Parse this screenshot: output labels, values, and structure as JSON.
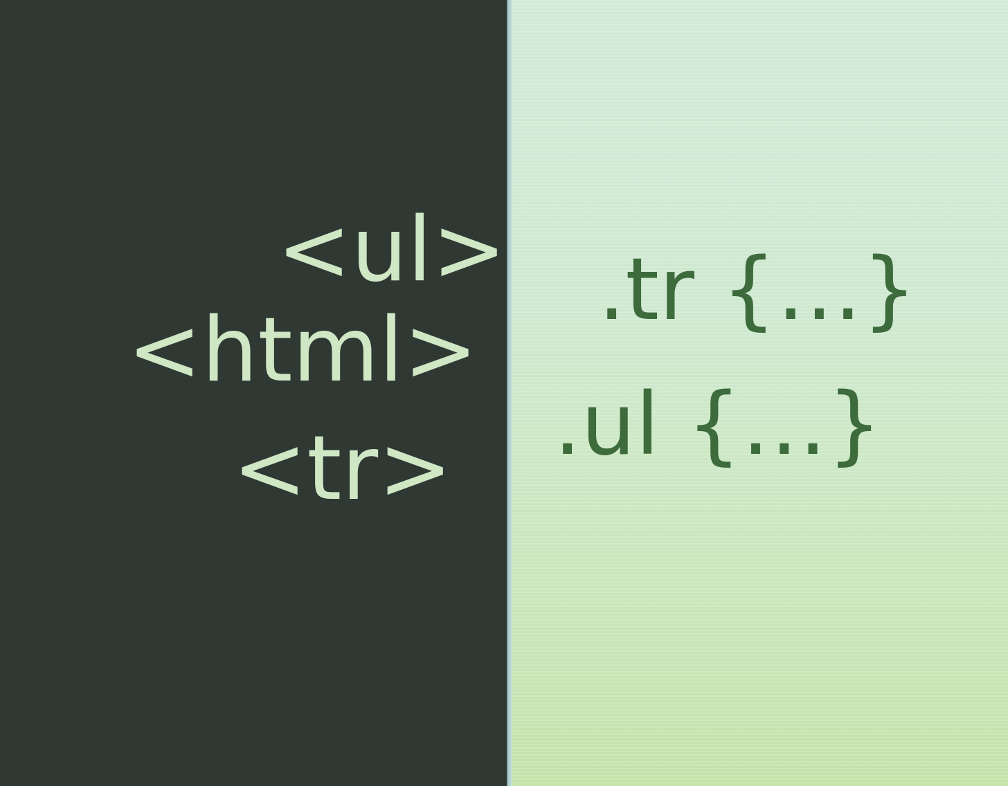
{
  "html_panel": {
    "tags": {
      "ul": "<ul>",
      "html": "<html>",
      "tr": "<tr>"
    }
  },
  "css_panel": {
    "rules": {
      "tr": ".tr {…}",
      "ul": ".ul {…}"
    }
  },
  "colors": {
    "left_background": "#2f3833",
    "tag_text": "#cfe7c4",
    "right_background": "#cde8c8",
    "rule_text": "#3d6b3c"
  }
}
